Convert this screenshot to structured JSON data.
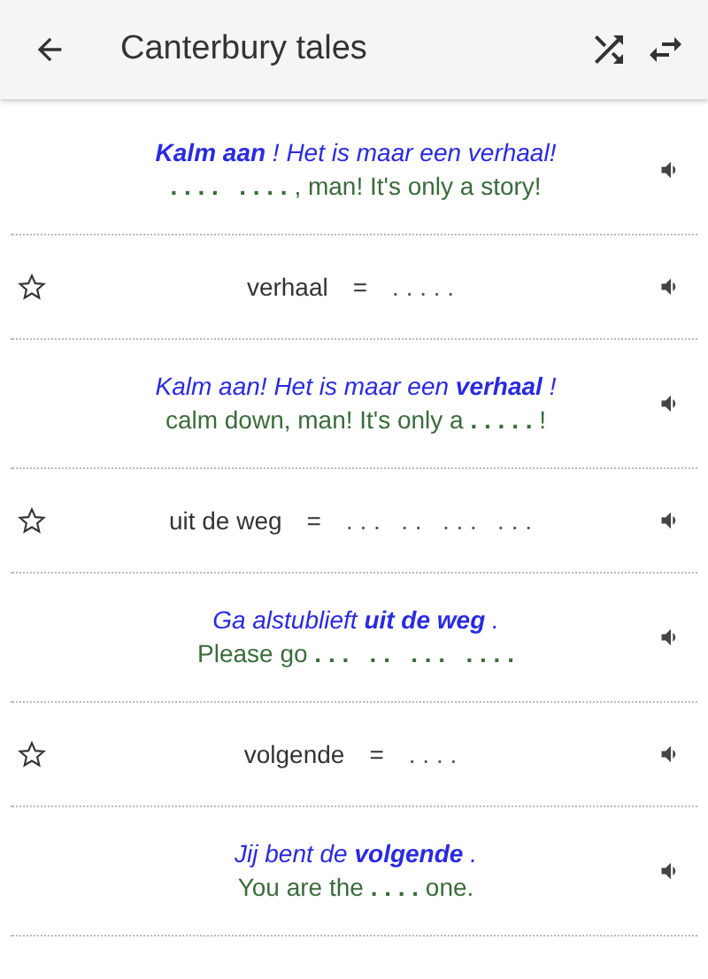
{
  "app_bar": {
    "title": "Canterbury tales"
  },
  "items": [
    {
      "kind": "sentence",
      "dutch": "**Kalm aan** ! Het is maar een verhaal!",
      "english": "**. . . .   . . . .** , man! It's only a story!"
    },
    {
      "kind": "word",
      "starred": false,
      "word": "verhaal",
      "equals": "=",
      "blank": ". . . . ."
    },
    {
      "kind": "sentence",
      "dutch": "Kalm aan! Het is maar een **verhaal** !",
      "english": "calm down, man! It's only a **. . . . .** !"
    },
    {
      "kind": "word",
      "starred": false,
      "word": "uit de weg",
      "equals": "=",
      "blank": ". . .   . .   . . .   . . ."
    },
    {
      "kind": "sentence",
      "dutch": "Ga alstublieft **uit de weg** .",
      "english": "Please go **. . .   . .   . . .   . . . .**"
    },
    {
      "kind": "word",
      "starred": false,
      "word": "volgende",
      "equals": "=",
      "blank": ". . . ."
    },
    {
      "kind": "sentence",
      "dutch": "Jij bent de **volgende** .",
      "english": "You are the **. . . .** one."
    }
  ]
}
